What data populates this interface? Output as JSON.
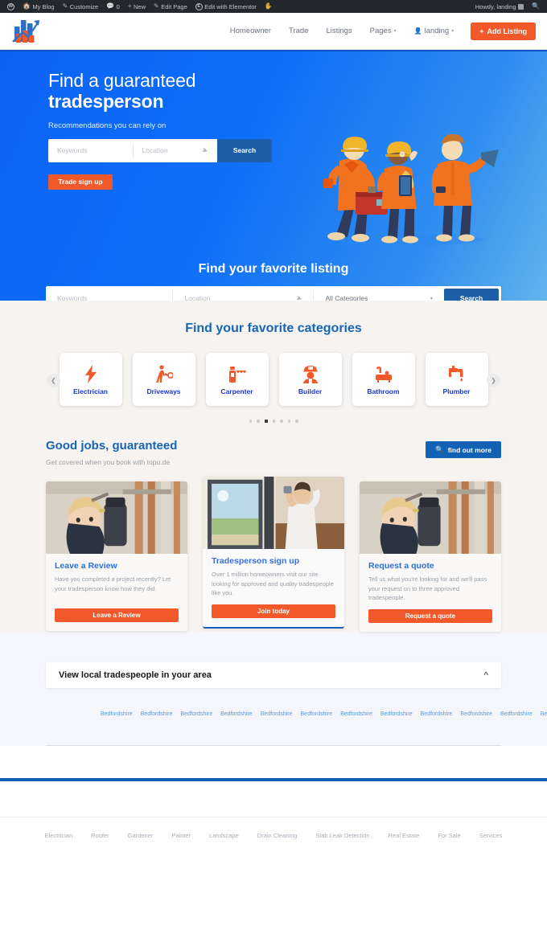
{
  "adminbar": {
    "wp_logo": "wordpress-logo-icon",
    "items": [
      {
        "icon": "home-icon",
        "label": "My Blog"
      },
      {
        "icon": "pencil-icon",
        "label": "Customize"
      },
      {
        "icon": "comment-icon",
        "label": "0"
      },
      {
        "icon": "plus-icon",
        "label": "New"
      },
      {
        "icon": "pencil-icon",
        "label": "Edit Page"
      },
      {
        "icon": "elementor-icon",
        "label": "Edit with Elementor"
      },
      {
        "icon": "hand-icon",
        "label": ""
      }
    ],
    "howdy": "Howdy, landing",
    "search_icon": "search-icon"
  },
  "header": {
    "logo_alt": "topu.de chart logo",
    "nav": [
      {
        "label": "Homeowner",
        "caret": false,
        "person": false
      },
      {
        "label": "Trade",
        "caret": false,
        "person": false
      },
      {
        "label": "Listings",
        "caret": false,
        "person": false
      },
      {
        "label": "Pages",
        "caret": true,
        "person": false
      },
      {
        "label": "landing",
        "caret": true,
        "person": true
      }
    ],
    "add_listing": "Add Listing",
    "add_listing_icon": "plus-icon"
  },
  "hero": {
    "title_line1": "Find a guaranteed",
    "title_line2": "tradesperson",
    "subtitle": "Recommendations you can rely on",
    "search": {
      "keywords_placeholder": "Keywords",
      "location_placeholder": "Location",
      "geo_icon": "locate-arrow-icon",
      "button": "Search"
    },
    "trade_signup": "Trade sign up",
    "illustration": "three-tradespeople-illustration"
  },
  "listing_search": {
    "title": "Find your favorite listing",
    "keywords_placeholder": "Keywords",
    "location_placeholder": "Location",
    "geo_icon": "locate-arrow-icon",
    "category_value": "All Categories",
    "category_caret": "chevron-down-icon",
    "button": "Search"
  },
  "categories": {
    "title": "Find your favorite categories",
    "prev_icon": "chevron-left-icon",
    "next_icon": "chevron-right-icon",
    "items": [
      {
        "label": "Electrician",
        "icon": "lightning-bolt-icon"
      },
      {
        "label": "Driveways",
        "icon": "worker-pushing-icon"
      },
      {
        "label": "Carpenter",
        "icon": "saw-icon"
      },
      {
        "label": "Builder",
        "icon": "builder-helmet-icon"
      },
      {
        "label": "Bathroom",
        "icon": "bathtub-icon"
      },
      {
        "label": "Plumber",
        "icon": "faucet-icon"
      }
    ],
    "dots_total": 7,
    "dots_active_index": 2
  },
  "good_jobs": {
    "title_plain": "Good jobs,",
    "title_accent": "guaranteed",
    "subtitle": "Get covered when you book with topu.de",
    "button": "find out more",
    "button_icon": "search-plus-icon"
  },
  "promo_cards": [
    {
      "image": "woman-plumber-photo",
      "heading": "Leave a Review",
      "body": "Have you completed a project recently? Let your tradesperson know how they did.",
      "button": "Leave a Review",
      "featured": false
    },
    {
      "image": "man-installing-window-photo",
      "heading": "Tradesperson sign up",
      "body": "Over 1 million homeowners visit our site looking for approved and quality tradespeople like you.",
      "button": "Join today",
      "featured": true
    },
    {
      "image": "woman-plumber-photo",
      "heading": "Request a quote",
      "body": "Tell us what you're looking for and we'll pass your request on to three approved tradespeople.",
      "button": "Request a quote",
      "featured": false
    }
  ],
  "accordion": {
    "title": "View local tradespeople in your area",
    "chevron": "chevron-up-icon",
    "region_label": "Bedfordshire",
    "region_count": 21
  },
  "footer": {
    "links": [
      "Electrician",
      "Roofer",
      "Gardener",
      "Painter",
      "Landscape",
      "Drain Cleaning",
      "Slab Leak Detection",
      "Real Estate",
      "For Sale",
      "Services"
    ]
  },
  "colors": {
    "orange": "#f1592a",
    "blue": "#1361b5",
    "hero_blue": "#0b63f6",
    "label_blue": "#1a36d8",
    "admin_dark": "#23282d"
  }
}
